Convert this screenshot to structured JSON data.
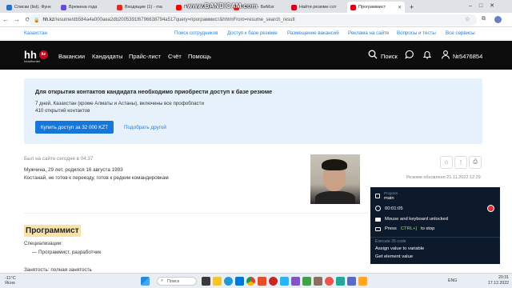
{
  "browser": {
    "tabs": [
      {
        "label": "Списки (list). Функ",
        "color": "#2d6fc2"
      },
      {
        "label": "Времена года",
        "color": "#6b4bd1"
      },
      {
        "label": "Входящие (1) - ma",
        "color": "#d93025"
      },
      {
        "label": "Почему Мафа 3 н",
        "color": "#ff0000"
      },
      {
        "label": "Ремонт - БиМэх",
        "color": "#d93025"
      },
      {
        "label": "Найти резюме сот",
        "color": "#d6001c"
      },
      {
        "label": "Программист",
        "color": "#d6001c"
      }
    ],
    "url_host": "hh.kz",
    "url_path": "/resume/db584a4a000aea2db2005391f6796638794a517query=программист&hhtmFrom=resume_search_result",
    "recorder_watermark": "www.BANDICAM.com"
  },
  "site": {
    "region": "Казахстан",
    "top_links": [
      "Поиск сотрудников",
      "Доступ к базе резюме",
      "Размещение вакансий",
      "Реклама на сайте",
      "Вопросы и тесты",
      "Все сервисы"
    ],
    "logo": "hh",
    "logo_sub": "headhunter",
    "logo_badge": "kz",
    "nav": [
      "Вакансии",
      "Кандидаты",
      "Прайс-лист",
      "Счёт",
      "Помощь"
    ],
    "search_label": "Поиск",
    "account": "№5476854"
  },
  "notice": {
    "title": "Для открытия контактов кандидата необходимо приобрести доступ к базе резюме",
    "line1": "7 дней, Казахстан (кроме Алматы и Астаны), включены все профобласти",
    "line2": "410 открытий контактов",
    "buy_button": "Купить доступ за 32 000 KZT",
    "other_link": "Подобрать другой"
  },
  "resume": {
    "last_seen": "Был на сайте сегодня в 04:37",
    "info1": "Мужчина, 29 лет, родился 16 августа 1993",
    "info2": "Костанай, не готов к переезду, готов к редким командировкам",
    "updated": "Резюме обновлено 21.11.2022 12:29",
    "title": "Программист",
    "spec_label": "Специализации:",
    "spec_item": "— Программист, разработчик",
    "employment": "Занятость: полная занятость"
  },
  "robot_panel": {
    "program_label": "Program",
    "program_name": "main",
    "timer": "00:01:05",
    "lock_status": "Mouse and keyboard unlocked",
    "stop_hint_pre": "Press",
    "stop_hint_key": "CTRL+]",
    "stop_hint_post": "to stop",
    "execute_line": "Execute 35 code",
    "step1": "Assign value to variable",
    "step2": "Get element value"
  },
  "taskbar": {
    "weather_temp": "-11°C",
    "weather_desc": "Ясно",
    "search": "Поиск",
    "lang": "ENG",
    "time": "20:31",
    "date": "17.12.2022"
  },
  "colors": {
    "accent_blue": "#1577d9",
    "link_blue": "#2a7fd4",
    "brand_red": "#d6001c",
    "header_black": "#0d0d0d",
    "highlight": "#f9e2a8"
  }
}
